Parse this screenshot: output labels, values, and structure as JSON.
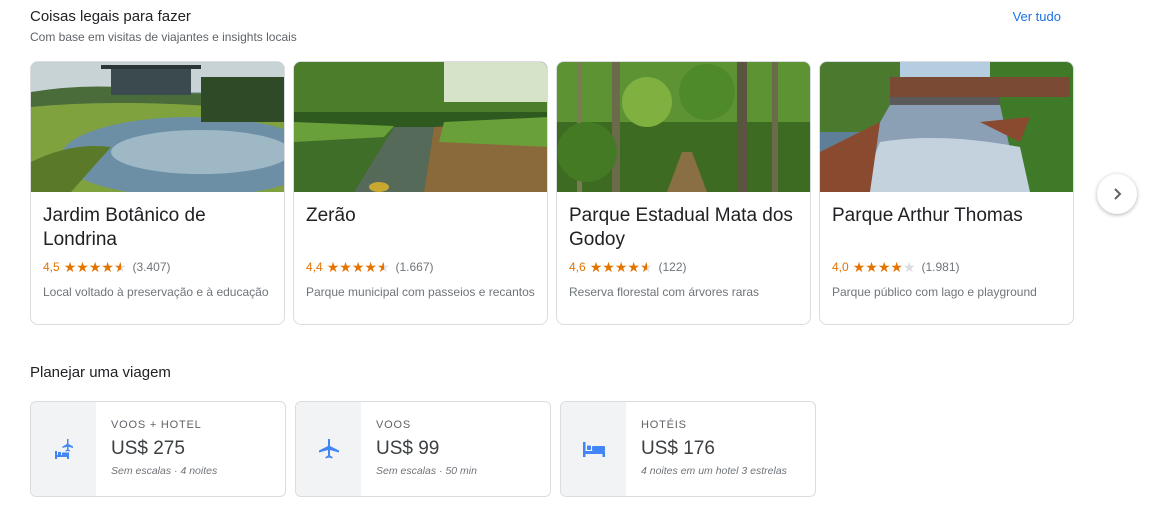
{
  "things": {
    "title": "Coisas legais para fazer",
    "subtitle": "Com base em visitas de viajantes e insights locais",
    "see_all": "Ver tudo",
    "cards": [
      {
        "name": "Jardim Botânico de Londrina",
        "rating": "4,5",
        "stars": [
          1,
          1,
          1,
          1,
          0.5
        ],
        "reviews": "(3.407)",
        "desc": "Local voltado à preservação e à educação"
      },
      {
        "name": "Zerão",
        "rating": "4,4",
        "stars": [
          1,
          1,
          1,
          1,
          0.5
        ],
        "reviews": "(1.667)",
        "desc": "Parque municipal com passeios e recantos"
      },
      {
        "name": "Parque Estadual Mata dos Godoy",
        "rating": "4,6",
        "stars": [
          1,
          1,
          1,
          1,
          0.5
        ],
        "reviews": "(122)",
        "desc": "Reserva florestal com árvores raras"
      },
      {
        "name": "Parque Arthur Thomas",
        "rating": "4,0",
        "stars": [
          1,
          1,
          1,
          1,
          0
        ],
        "reviews": "(1.981)",
        "desc": "Parque público com lago e playground"
      }
    ]
  },
  "plan": {
    "title": "Planejar uma viagem",
    "cards": [
      {
        "label": "VOOS + HOTEL",
        "price": "US$ 275",
        "note": "Sem escalas · 4 noites",
        "icon": "flight-hotel-icon"
      },
      {
        "label": "VOOS",
        "price": "US$ 99",
        "note": "Sem escalas · 50 min",
        "icon": "airplane-icon"
      },
      {
        "label": "HOTÉIS",
        "price": "US$ 176",
        "note": "4 noites em um hotel 3 estrelas",
        "icon": "hotel-bed-icon"
      }
    ]
  },
  "colors": {
    "accent": "#1a73e8",
    "star": "#e37400",
    "icon_blue": "#4285f4"
  }
}
